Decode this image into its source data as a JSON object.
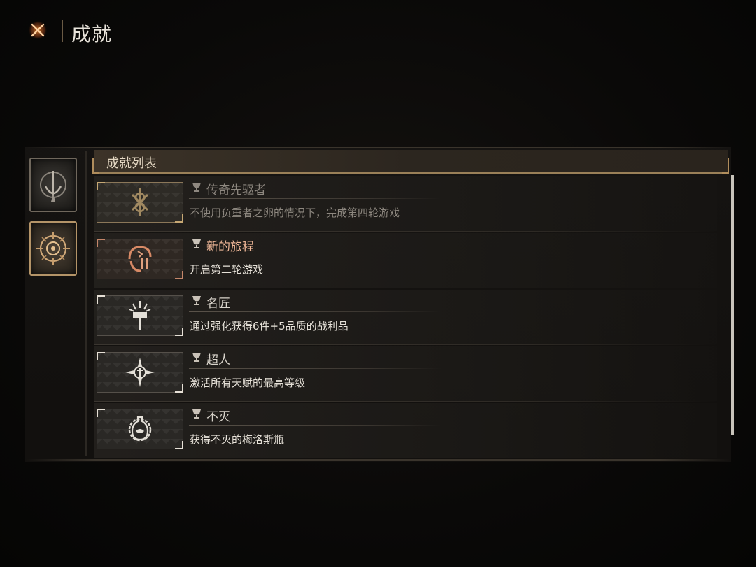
{
  "header": {
    "title": "成就",
    "close_icon": "close-x-icon",
    "accent_color": "#e07a2a"
  },
  "sidebar": {
    "tabs": [
      {
        "icon": "crescent-blade-emblem-icon",
        "active": false
      },
      {
        "icon": "compass-sun-emblem-icon",
        "active": true
      }
    ]
  },
  "list": {
    "header_label": "成就列表",
    "scroll_position": 0.0,
    "items": [
      {
        "title": "传奇先驱者",
        "description": "不使用负重者之卵的情况下，完成第四轮游戏",
        "icon": "rune-knot-icon",
        "style": "gold",
        "faded": true
      },
      {
        "title": "新的旅程",
        "description": "开启第二轮游戏",
        "icon": "dragon-roman-ii-icon",
        "style": "copper",
        "faded": false
      },
      {
        "title": "名匠",
        "description": "通过强化获得6件+5品质的战利品",
        "icon": "hammer-burst-icon",
        "style": "silver",
        "faded": false
      },
      {
        "title": "超人",
        "description": "激活所有天赋的最高等级",
        "icon": "star-rune-icon",
        "style": "silver",
        "faded": false
      },
      {
        "title": "不灭",
        "description": "获得不灭的梅洛斯瓶",
        "icon": "ornate-flask-icon",
        "style": "silver",
        "faded": false
      }
    ]
  }
}
